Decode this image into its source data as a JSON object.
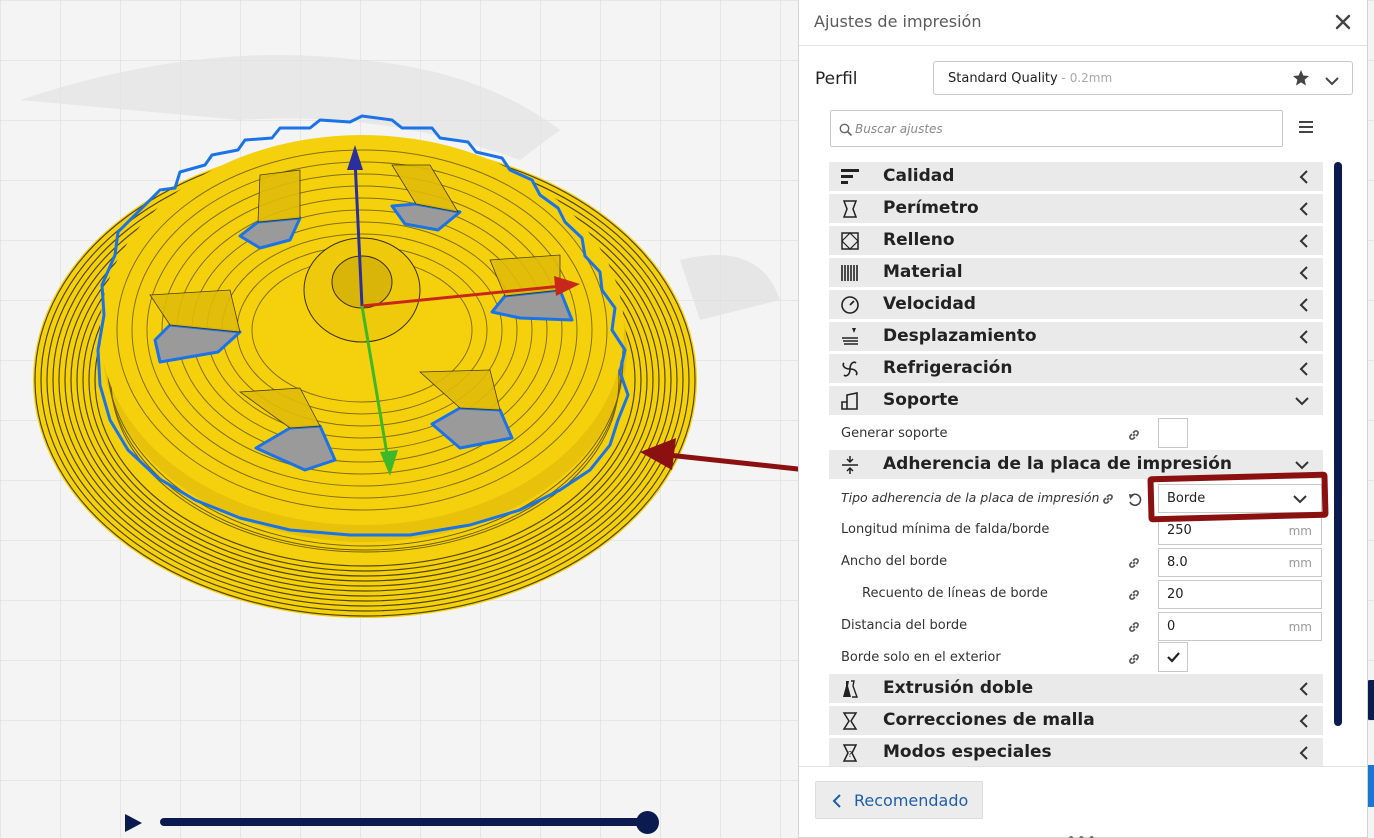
{
  "panel": {
    "title": "Ajustes de impresión",
    "profile": {
      "label": "Perfil",
      "name": "Standard Quality",
      "layer_height": " - 0.2mm"
    },
    "search": {
      "placeholder": "Buscar ajustes"
    },
    "categories_top": [
      {
        "label": "Calidad",
        "icon": "quality-icon"
      },
      {
        "label": "Perímetro",
        "icon": "shell-icon"
      },
      {
        "label": "Relleno",
        "icon": "infill-icon"
      },
      {
        "label": "Material",
        "icon": "material-icon"
      },
      {
        "label": "Velocidad",
        "icon": "speed-icon"
      },
      {
        "label": "Desplazamiento",
        "icon": "travel-icon"
      },
      {
        "label": "Refrigeración",
        "icon": "fan-icon"
      },
      {
        "label": "Soporte",
        "icon": "support-icon"
      }
    ],
    "support_settings": {
      "generate_support_label": "Generar soporte",
      "generate_support_checked": false
    },
    "adhesion": {
      "label": "Adherencia de la placa de impresión",
      "icon": "adhesion-icon",
      "type_label": "Tipo adherencia de la placa de impresión",
      "type_value": "Borde",
      "settings": [
        {
          "label": "Longitud mínima de falda/borde",
          "value": "250",
          "unit": "mm"
        },
        {
          "label": "Ancho del borde",
          "value": "8.0",
          "unit": "mm"
        },
        {
          "label": "Recuento de líneas de borde",
          "value": "20",
          "unit": ""
        },
        {
          "label": "Distancia del borde",
          "value": "0",
          "unit": "mm"
        }
      ],
      "outside_only_label": "Borde solo en el exterior",
      "outside_only_checked": true
    },
    "categories_bottom": [
      {
        "label": "Extrusión doble",
        "icon": "dual-extrusion-icon"
      },
      {
        "label": "Correcciones de malla",
        "icon": "mesh-fix-icon"
      },
      {
        "label": "Modos especiales",
        "icon": "special-modes-icon"
      }
    ],
    "footer": {
      "recommended_label": "Recomendado"
    }
  },
  "colors": {
    "model_yellow": "#f5d10d",
    "outline_blue": "#1a73e8",
    "annotation_red": "#8b1111",
    "dark_navy": "#0b1a4f",
    "link_blue": "#1e5ea8"
  }
}
